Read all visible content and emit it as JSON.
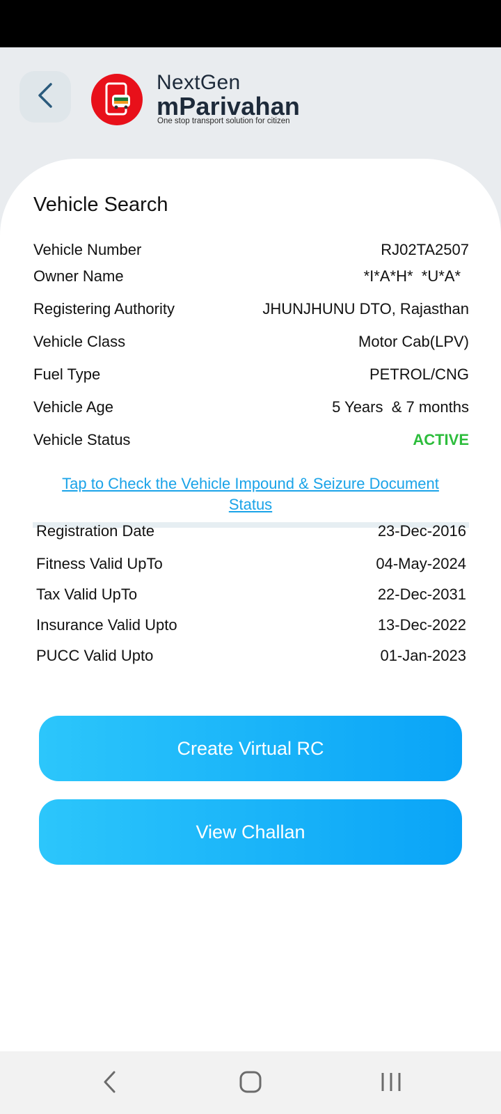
{
  "header": {
    "brand_top": "NextGen",
    "brand_main": "mParivahan",
    "brand_tagline": "One stop transport solution for citizen"
  },
  "card": {
    "title": "Vehicle Search",
    "details": [
      {
        "label": "Vehicle Number",
        "value": "RJ02TA2507"
      },
      {
        "label": "Owner Name",
        "value": "*I*A*H*  *U*A*"
      },
      {
        "label": "Registering Authority",
        "value": "JHUNJHUNU DTO, Rajasthan"
      },
      {
        "label": "Vehicle Class",
        "value": "Motor Cab(LPV)"
      },
      {
        "label": "Fuel Type",
        "value": "PETROL/CNG"
      },
      {
        "label": "Vehicle Age",
        "value": "5 Years  & 7 months"
      },
      {
        "label": "Vehicle Status",
        "value": "ACTIVE"
      }
    ],
    "impound_link": "Tap to Check the Vehicle Impound & Seizure Document Status",
    "validity": [
      {
        "label": "Registration Date",
        "value": "23-Dec-2016"
      },
      {
        "label": "Fitness Valid UpTo",
        "value": "04-May-2024"
      },
      {
        "label": "Tax Valid UpTo",
        "value": "22-Dec-2031"
      },
      {
        "label": "Insurance Valid Upto",
        "value": "13-Dec-2022"
      },
      {
        "label": "PUCC Valid Upto",
        "value": "01-Jan-2023"
      }
    ]
  },
  "actions": {
    "create_rc": "Create Virtual RC",
    "view_challan": "View Challan"
  },
  "icons": {
    "back": "chevron-left-icon",
    "nav_back": "nav-back-icon",
    "nav_home": "nav-home-icon",
    "nav_recents": "nav-recents-icon"
  },
  "colors": {
    "logo_red": "#e8101a",
    "status_active": "#2dbd3c",
    "link": "#1aa3e8",
    "button_start": "#2cc6fb",
    "button_end": "#0aa4f7"
  }
}
